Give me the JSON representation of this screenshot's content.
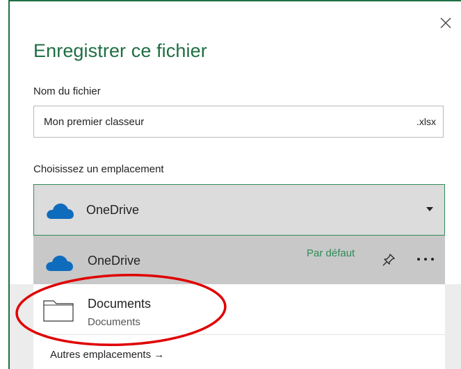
{
  "dialog": {
    "title": "Enregistrer ce fichier",
    "close_label": "×"
  },
  "filename": {
    "label": "Nom du fichier",
    "value": "Mon premier classeur",
    "extension": ".xlsx"
  },
  "location": {
    "label": "Choisissez un emplacement",
    "selected": "OneDrive",
    "options": [
      {
        "name": "OneDrive",
        "badge": "Par défaut",
        "icon": "onedrive-cloud-icon"
      },
      {
        "name": "Documents",
        "subtitle": "Documents",
        "icon": "folder-icon"
      }
    ],
    "more_link": "Autres emplacements →"
  },
  "colors": {
    "accent": "#1f6e43",
    "cloud": "#0f6cbd",
    "annotation": "#e00000",
    "selected_bg": "#dcdcdc",
    "hover_bg": "#c8c8c8"
  }
}
